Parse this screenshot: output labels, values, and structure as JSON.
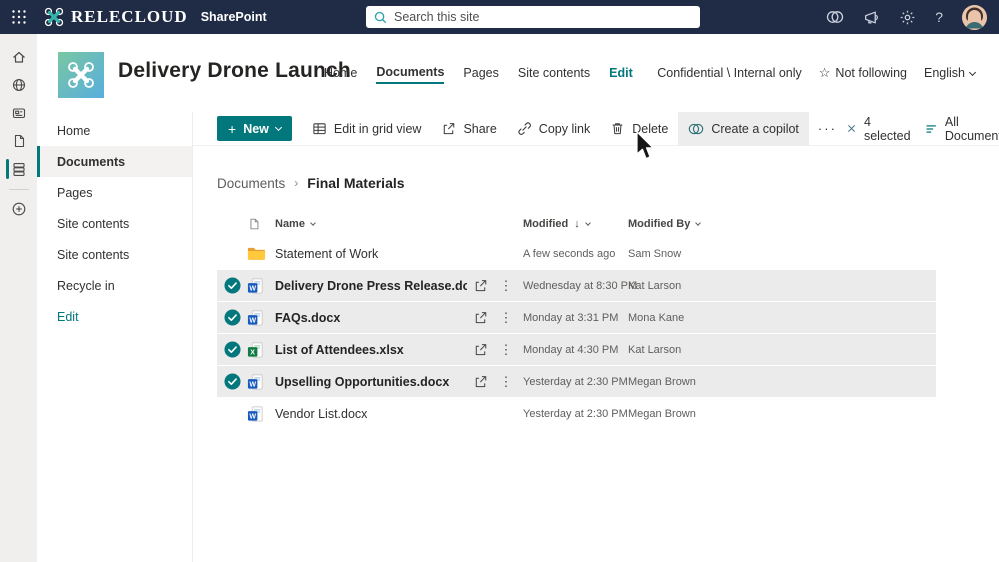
{
  "topbar": {
    "brand": "RELECLOUD",
    "app": "SharePoint",
    "search_placeholder": "Search this site"
  },
  "site": {
    "title": "Delivery Drone Launch",
    "nav": [
      {
        "label": "Home"
      },
      {
        "label": "Documents"
      },
      {
        "label": "Pages"
      },
      {
        "label": "Site contents"
      },
      {
        "label": "Edit"
      }
    ],
    "classification": "Confidential \\ Internal only",
    "follow": "Not following",
    "language": "English"
  },
  "sidebar": {
    "items": [
      {
        "label": "Home"
      },
      {
        "label": "Documents"
      },
      {
        "label": "Pages"
      },
      {
        "label": "Site contents"
      },
      {
        "label": "Site contents"
      },
      {
        "label": "Recycle in"
      },
      {
        "label": "Edit"
      }
    ]
  },
  "toolbar": {
    "new_label": "New",
    "actions": [
      {
        "label": "Edit in grid view"
      },
      {
        "label": "Share"
      },
      {
        "label": "Copy link"
      },
      {
        "label": "Delete"
      },
      {
        "label": "Create a copilot"
      }
    ],
    "overflow": "···",
    "selected_label": "4 selected",
    "view_label": "All Documents"
  },
  "breadcrumb": {
    "parent": "Documents",
    "current": "Final Materials"
  },
  "table": {
    "headers": {
      "name": "Name",
      "modified": "Modified",
      "modified_by": "Modified By"
    },
    "rows": [
      {
        "name": "Statement of Work",
        "modified": "A few seconds ago",
        "by": "Sam Snow"
      },
      {
        "name": "Delivery Drone Press Release.docx",
        "modified": "Wednesday at 8:30 PM",
        "by": "Kat Larson"
      },
      {
        "name": "FAQs.docx",
        "modified": "Monday at 3:31 PM",
        "by": "Mona Kane"
      },
      {
        "name": "List of Attendees.xlsx",
        "modified": "Monday at 4:30 PM",
        "by": "Kat Larson"
      },
      {
        "name": "Upselling Opportunities.docx",
        "modified": "Yesterday at 2:30 PM",
        "by": "Megan Brown"
      },
      {
        "name": "Vendor List.docx",
        "modified": "Yesterday at 2:30 PM",
        "by": "Megan Brown"
      }
    ]
  },
  "icons": {
    "word_letter": "W",
    "excel_letter": "X"
  },
  "colors": {
    "accent": "#03787c",
    "topbar_bg": "#202b45",
    "selected_row": "#ebebeb",
    "word_blue": "#185abd",
    "excel_green": "#107c41",
    "folder_yellow": "#ffc83d"
  }
}
